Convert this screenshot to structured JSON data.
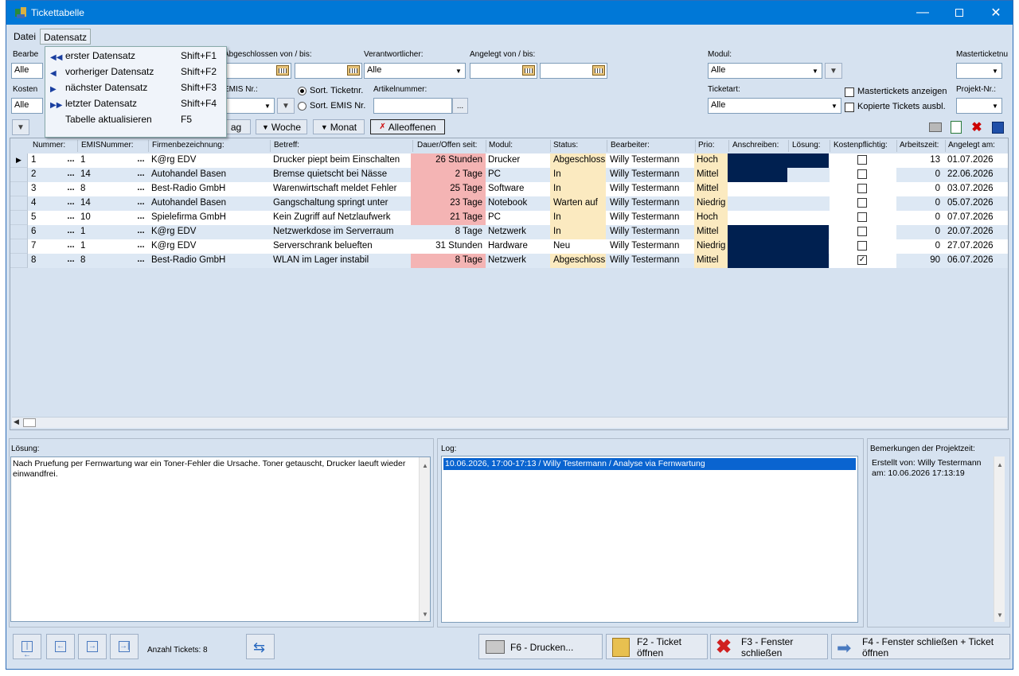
{
  "window": {
    "title": "Tickettabelle"
  },
  "menubar": {
    "datei": "Datei",
    "datensatz": "Datensatz"
  },
  "menu": {
    "items": [
      {
        "label": "erster Datensatz",
        "shortcut": "Shift+F1",
        "icon": "first-record-icon"
      },
      {
        "label": "vorheriger Datensatz",
        "shortcut": "Shift+F2",
        "icon": "prev-record-icon"
      },
      {
        "label": "nächster Datensatz",
        "shortcut": "Shift+F3",
        "icon": "next-record-icon"
      },
      {
        "label": "letzter Datensatz",
        "shortcut": "Shift+F4",
        "icon": "last-record-icon"
      },
      {
        "label": "Tabelle aktualisieren",
        "shortcut": "F5",
        "icon": ""
      }
    ]
  },
  "filters": {
    "bearbeiter_label": "Bearbe",
    "bearbeiter_value": "Alle",
    "kosten_label": "Kosten",
    "kosten_value": "Alle",
    "abgeschlossen_label": "Abgeschlossen von / bis:",
    "verantwortlicher_label": "Verantwortlicher:",
    "verantwortlicher_value": "Alle",
    "angelegt_label": "Angelegt von / bis:",
    "modul_label": "Modul:",
    "modul_value": "Alle",
    "masterticket_label": "Masterticketnu",
    "emis_label": "EMIS Nr.:",
    "sort_ticket": "Sort. Ticketnr.",
    "sort_emis": "Sort. EMIS Nr.",
    "artikel_label": "Artikelnummer:",
    "ticketart_label": "Ticketart:",
    "ticketart_value": "Alle",
    "mastertickets_anzeigen": "Mastertickets anzeigen",
    "kopierte_tickets": "Kopierte Tickets ausbl.",
    "projekt_label": "Projekt-Nr.:",
    "tag_button": "ag",
    "woche_button": "Woche",
    "monat_button": "Monat",
    "alleoffenen_button": "Alleoffenen"
  },
  "table": {
    "columns": [
      "Nummer:",
      "EMISNummer:",
      "Firmenbezeichnung:",
      "Betreff:",
      "Dauer/Offen seit:",
      "Modul:",
      "Status:",
      "Bearbeiter:",
      "Prio:",
      "Anschreiben:",
      "Lösung:",
      "Kostenpflichtig:",
      "Arbeitszeit:",
      "Angelegt am:"
    ],
    "rows": [
      {
        "nr": "1",
        "emis": "1",
        "firma": "K@rg EDV",
        "betreff": "Drucker piept beim Einschalten",
        "dauer": "26 Stunden",
        "dauer_red": true,
        "modul": "Drucker",
        "status": "Abgeschloss",
        "status_yellow": true,
        "bearbeiter": "Willy Testermann",
        "prio": "Hoch",
        "anschreiben": "full",
        "kosten": false,
        "arbeitszeit": "13",
        "angelegt": "01.07.2026"
      },
      {
        "nr": "2",
        "emis": "14",
        "firma": "Autohandel Basen",
        "betreff": "Bremse quietscht bei Nässe",
        "dauer": "2 Tage",
        "dauer_red": true,
        "modul": "PC",
        "status": "In",
        "status_yellow": true,
        "bearbeiter": "Willy Testermann",
        "prio": "Mittel",
        "anschreiben": "half",
        "kosten": false,
        "arbeitszeit": "0",
        "angelegt": "22.06.2026"
      },
      {
        "nr": "3",
        "emis": "8",
        "firma": "Best-Radio GmbH",
        "betreff": "Warenwirtschaft meldet Fehler",
        "dauer": "25 Tage",
        "dauer_red": true,
        "modul": "Software",
        "status": "In",
        "status_yellow": true,
        "bearbeiter": "Willy Testermann",
        "prio": "Mittel",
        "anschreiben": "none",
        "kosten": false,
        "arbeitszeit": "0",
        "angelegt": "03.07.2026"
      },
      {
        "nr": "4",
        "emis": "14",
        "firma": "Autohandel Basen",
        "betreff": "Gangschaltung springt unter",
        "dauer": "23 Tage",
        "dauer_red": true,
        "modul": "Notebook",
        "status": "Warten auf",
        "status_yellow": true,
        "bearbeiter": "Willy Testermann",
        "prio": "Niedrig",
        "anschreiben": "none",
        "kosten": false,
        "arbeitszeit": "0",
        "angelegt": "05.07.2026"
      },
      {
        "nr": "5",
        "emis": "10",
        "firma": "Spielefirma GmbH",
        "betreff": "Kein Zugriff auf Netzlaufwerk",
        "dauer": "21 Tage",
        "dauer_red": true,
        "modul": "PC",
        "status": "In",
        "status_yellow": true,
        "bearbeiter": "Willy Testermann",
        "prio": "Hoch",
        "anschreiben": "none",
        "kosten": false,
        "arbeitszeit": "0",
        "angelegt": "07.07.2026"
      },
      {
        "nr": "6",
        "emis": "1",
        "firma": "K@rg EDV",
        "betreff": "Netzwerkdose im Serverraum",
        "dauer": "8 Tage",
        "dauer_red": false,
        "modul": "Netzwerk",
        "status": "In",
        "status_yellow": true,
        "bearbeiter": "Willy Testermann",
        "prio": "Mittel",
        "anschreiben": "full",
        "kosten": false,
        "arbeitszeit": "0",
        "angelegt": "20.07.2026"
      },
      {
        "nr": "7",
        "emis": "1",
        "firma": "K@rg EDV",
        "betreff": "Serverschrank belueften",
        "dauer": "31 Stunden",
        "dauer_red": false,
        "modul": "Hardware",
        "status": "Neu",
        "status_yellow": false,
        "bearbeiter": "Willy Testermann",
        "prio": "Niedrig",
        "anschreiben": "full",
        "kosten": false,
        "arbeitszeit": "0",
        "angelegt": "27.07.2026"
      },
      {
        "nr": "8",
        "emis": "8",
        "firma": "Best-Radio GmbH",
        "betreff": "WLAN im Lager instabil",
        "dauer": "8 Tage",
        "dauer_red": true,
        "modul": "Netzwerk",
        "status": "Abgeschloss",
        "status_yellow": true,
        "bearbeiter": "Willy Testermann",
        "prio": "Mittel",
        "anschreiben": "full",
        "kosten": true,
        "arbeitszeit": "90",
        "angelegt": "06.07.2026"
      }
    ]
  },
  "loesung": {
    "label": "Lösung:",
    "text": "Nach Pruefung per Fernwartung war ein Toner-Fehler die Ursache. Toner getauscht, Drucker laeuft wieder einwandfrei."
  },
  "log": {
    "label": "Log:",
    "entry": "10.06.2026, 17:00-17:13 / Willy Testermann / Analyse via Fernwartung"
  },
  "bemerkungen": {
    "label": "Bemerkungen der Projektzeit:",
    "text": "Erstellt von: Willy Testermann am: 10.06.2026 17:13:19"
  },
  "footer": {
    "anzahl": "Anzahl Tickets: 8",
    "drucken": "F6 - Drucken...",
    "ticket_oeffnen": "F2 - Ticket öffnen",
    "fenster_schliessen": "F3 - Fenster schließen",
    "schliessen_oeffnen": "F4 - Fenster schließen + Ticket öffnen"
  },
  "colors": {
    "titlebar": "#0078d7",
    "red_cell": "#f4b4b4",
    "yellow_cell": "#fbeac0",
    "navy_bar": "#002050",
    "selection": "#0a64d0"
  }
}
